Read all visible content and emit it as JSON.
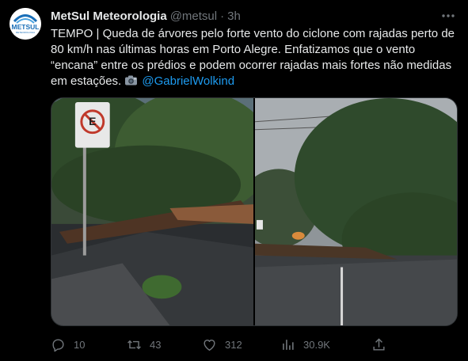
{
  "author": {
    "display_name": "MetSul Meteorologia",
    "handle": "@metsul",
    "separator": "·",
    "time": "3h",
    "avatar_text": "METSUL",
    "avatar_subtext": "METEOROLOGIA"
  },
  "tweet": {
    "text": "TEMPO | Queda de árvores pelo forte vento do ciclone com rajadas perto de 80 km/h nas últimas horas em Porto Alegre. Enfatizamos que o vento “encana” entre os prédios e podem ocorrer rajadas mais fortes não medidas em estações.",
    "photo_credit": "@GabrielWolkind"
  },
  "media": {
    "photos": [
      {
        "description_icon": "photo-fallen-tree-sidewalk"
      },
      {
        "description_icon": "photo-fallen-tree-street"
      }
    ]
  },
  "actions": {
    "replies": "10",
    "retweets": "43",
    "likes": "312",
    "views": "30.9K"
  },
  "colors": {
    "background": "#000000",
    "text": "#e7e9ea",
    "muted": "#71767b",
    "link": "#1d9bf0",
    "avatar_blue": "#1a6fb8"
  }
}
